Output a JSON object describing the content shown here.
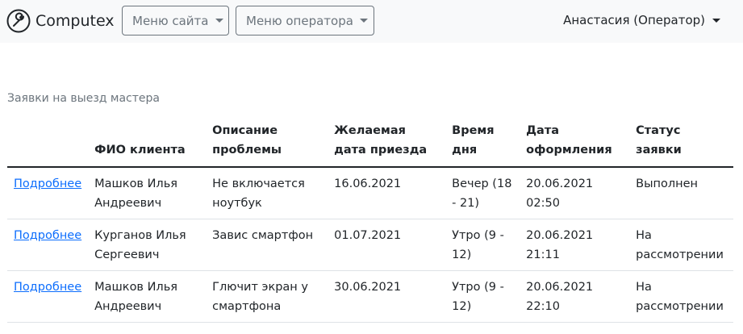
{
  "navbar": {
    "brand": "Computex",
    "brand_icon": "wrench-icon",
    "site_menu_label": "Меню сайта",
    "operator_menu_label": "Меню оператора",
    "user_label": "Анастасия (Оператор)"
  },
  "table": {
    "caption": "Заявки на выезд мастера",
    "headers": {
      "link": "",
      "fio": "ФИО клиента",
      "desc": "Описание проблемы",
      "date": "Желаемая дата приезда",
      "time": "Время дня",
      "registered": "Дата оформления",
      "status": "Статус заявки"
    },
    "rows": [
      {
        "link": "Подробнее",
        "fio": "Машков Илья Андреевич",
        "desc": "Не включается ноутбук",
        "date": "16.06.2021",
        "time": "Вечер (18 - 21)",
        "registered": "20.06.2021 02:50",
        "status": "Выполнен"
      },
      {
        "link": "Подробнее",
        "fio": "Курганов Илья Сергеевич",
        "desc": "Завис смартфон",
        "date": "01.07.2021",
        "time": "Утро (9 - 12)",
        "registered": "20.06.2021 21:11",
        "status": "На рассмотрении"
      },
      {
        "link": "Подробнее",
        "fio": "Машков Илья Андреевич",
        "desc": "Глючит экран у смартфона",
        "date": "30.06.2021",
        "time": "Утро (9 - 12)",
        "registered": "20.06.2021 22:10",
        "status": "На рассмотрении"
      }
    ]
  },
  "colors": {
    "navbar_bg": "#f8f9fa",
    "link": "#0d6efd",
    "muted": "#6c757d"
  }
}
